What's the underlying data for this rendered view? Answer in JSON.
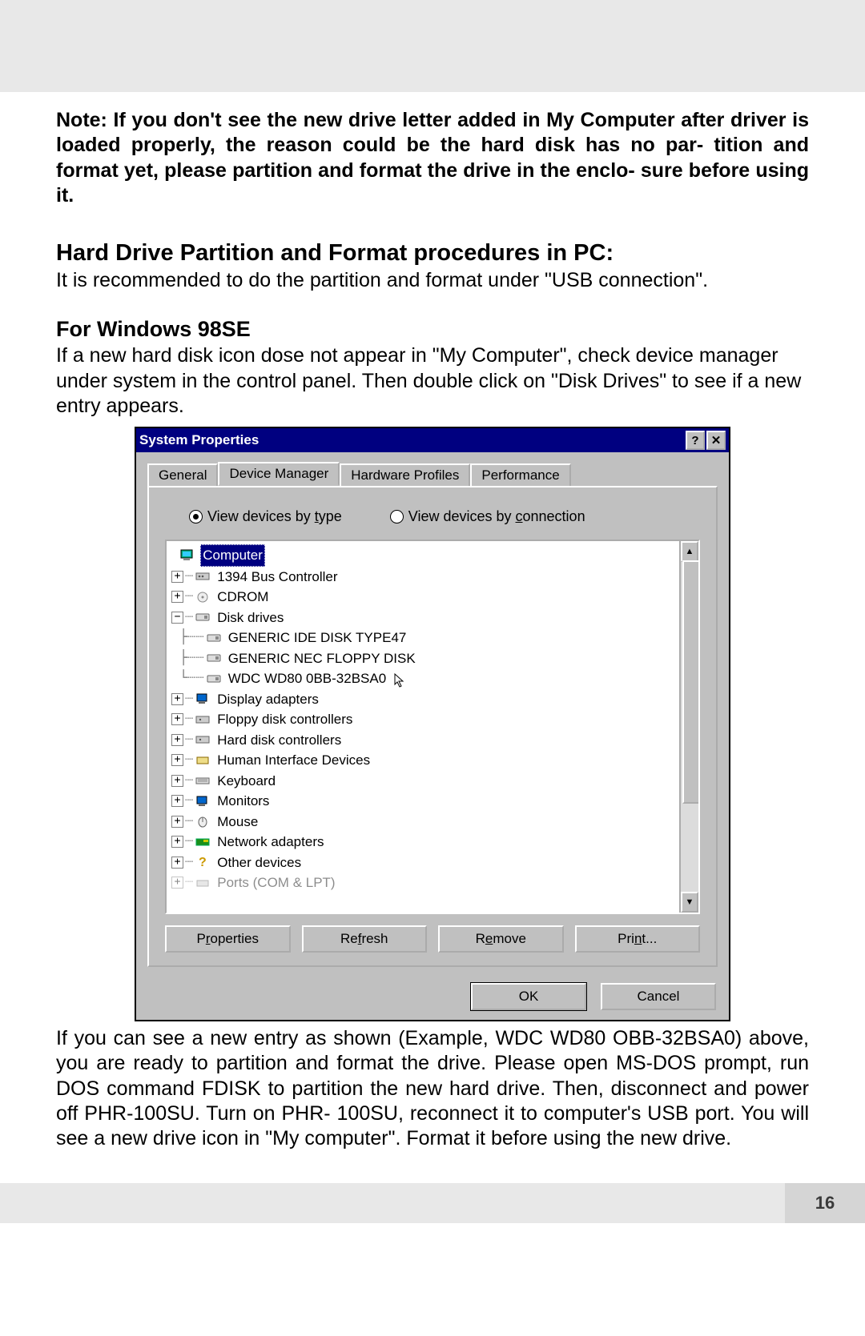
{
  "doc": {
    "note": "Note: If you don't see the new drive letter added in My Computer after driver is loaded properly, the reason could be the hard disk has no par- tition and format yet, please partition and format the drive in the enclo- sure before using it.",
    "h1": "Hard Drive Partition and Format procedures in PC:",
    "p1": "It is recommended to do the partition and format under \"USB connection\".",
    "h2": "For Windows 98SE",
    "p2": "If a new hard disk icon dose not appear in \"My Computer\", check device manager under system in the control panel. Then double click on \"Disk Drives\" to see if a new entry appears.",
    "after": "If you can see a new entry as shown (Example, WDC WD80 OBB-32BSA0) above, you are ready to partition and format the drive. Please open MS-DOS prompt, run DOS command FDISK to partition the new hard drive. Then, disconnect and power off PHR-100SU. Turn on PHR- 100SU, reconnect it to computer's USB port. You will see a new drive icon in \"My computer\". Format it before using the new drive.",
    "page_number": "16"
  },
  "win": {
    "title": "System Properties",
    "help_glyph": "?",
    "close_glyph": "✕",
    "tabs": {
      "general": "General",
      "devmgr": "Device Manager",
      "hw": "Hardware Profiles",
      "perf": "Performance"
    },
    "radio": {
      "by_type": "View devices by type",
      "by_conn": "View devices by connection"
    },
    "tree": {
      "computer": "Computer",
      "n1394": "1394 Bus Controller",
      "cdrom": "CDROM",
      "disk": "Disk drives",
      "disk1": "GENERIC IDE  DISK TYPE47",
      "disk2": "GENERIC NEC  FLOPPY DISK",
      "disk3": "WDC WD80 0BB-32BSA0",
      "display": "Display adapters",
      "floppyctl": "Floppy disk controllers",
      "hdctl": "Hard disk controllers",
      "hid": "Human Interface Devices",
      "keyboard": "Keyboard",
      "monitors": "Monitors",
      "mouse": "Mouse",
      "netadapters": "Network adapters",
      "other": "Other devices",
      "ports": "Ports (COM & LPT)"
    },
    "buttons": {
      "properties": "Properties",
      "refresh": "Refresh",
      "remove": "Remove",
      "print": "Print...",
      "ok": "OK",
      "cancel": "Cancel"
    }
  }
}
